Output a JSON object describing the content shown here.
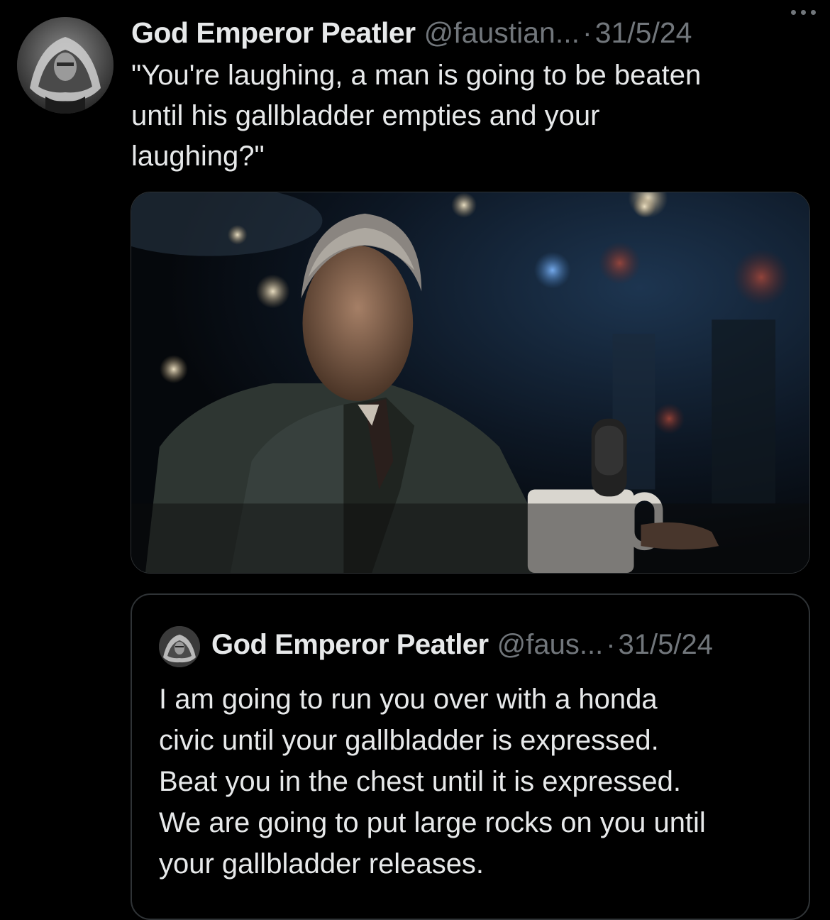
{
  "tweet": {
    "display_name": "God Emperor Peatler",
    "handle": "@faustian...",
    "separator": "·",
    "date": "31/5/24",
    "more_icon": "more-horizontal-icon",
    "text": "\"You're laughing, a man is going to be beaten\nuntil his gallbladder empties and your\nlaughing?\"",
    "avatar_icon": "profile-avatar"
  },
  "media": {
    "description_icon": "photo-media"
  },
  "quote": {
    "display_name": "God Emperor Peatler",
    "handle": "@faus...",
    "separator": "·",
    "date": "31/5/24",
    "text": "I am going to run you over with a honda\ncivic until your gallbladder is expressed.\nBeat you in the chest until it is expressed.\nWe are going to put large rocks on you until\nyour gallbladder releases."
  },
  "colors": {
    "background": "#000000",
    "text_primary": "#e7e9ea",
    "text_secondary": "#71767b",
    "border": "#2f3336"
  }
}
